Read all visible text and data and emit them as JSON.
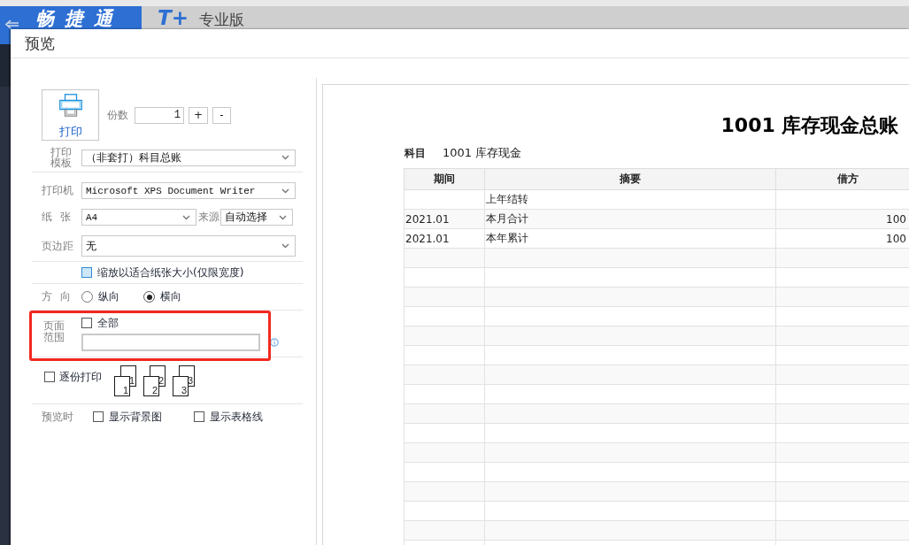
{
  "app_header": {
    "brand": "畅捷通",
    "logo": "T+",
    "edition": "专业版"
  },
  "dialog": {
    "title": "预览"
  },
  "print_button": {
    "label": "打印"
  },
  "copies": {
    "label": "份数",
    "value": "1",
    "increment": "+",
    "decrement": "-"
  },
  "template": {
    "label": "打印模板",
    "value": "（非套打）科目总账"
  },
  "printer": {
    "label": "打印机",
    "value": "Microsoft XPS Document Writer"
  },
  "paper": {
    "label": "纸 张",
    "value": "A4",
    "source_label": "来源",
    "source_value": "自动选择"
  },
  "margin": {
    "label": "页边距",
    "value": "无"
  },
  "fit_width": {
    "label": "缩放以适合纸张大小(仅限宽度)",
    "checked": false,
    "highlighted": true
  },
  "orientation": {
    "label": "方 向",
    "options": [
      {
        "label": "纵向",
        "selected": false
      },
      {
        "label": "横向",
        "selected": true
      }
    ]
  },
  "page_range": {
    "label": "页面范围",
    "highlighted": true,
    "all": {
      "label": "全部",
      "checked": false
    }
  },
  "collate": {
    "label": "逐份打印",
    "checked": false,
    "sets": [
      {
        "back": "1",
        "front": "1"
      },
      {
        "back": "2",
        "front": "2"
      },
      {
        "back": "3",
        "front": "3"
      }
    ]
  },
  "preview_options": {
    "label": "预览时",
    "options": [
      {
        "label": "显示背景图",
        "checked": false
      },
      {
        "label": "显示表格线",
        "checked": false
      }
    ]
  },
  "preview": {
    "title": "1001 库存现金总账",
    "subject_label": "科目",
    "subject": "1001 库存现金",
    "columns": [
      "期间",
      "摘要",
      "借方"
    ],
    "rows": [
      {
        "summary": "上年结转"
      },
      {
        "period": "2021.01",
        "summary": "本月合计",
        "debit": "100"
      },
      {
        "period": "2021.01",
        "summary": "本年累计",
        "debit": "100"
      }
    ]
  }
}
